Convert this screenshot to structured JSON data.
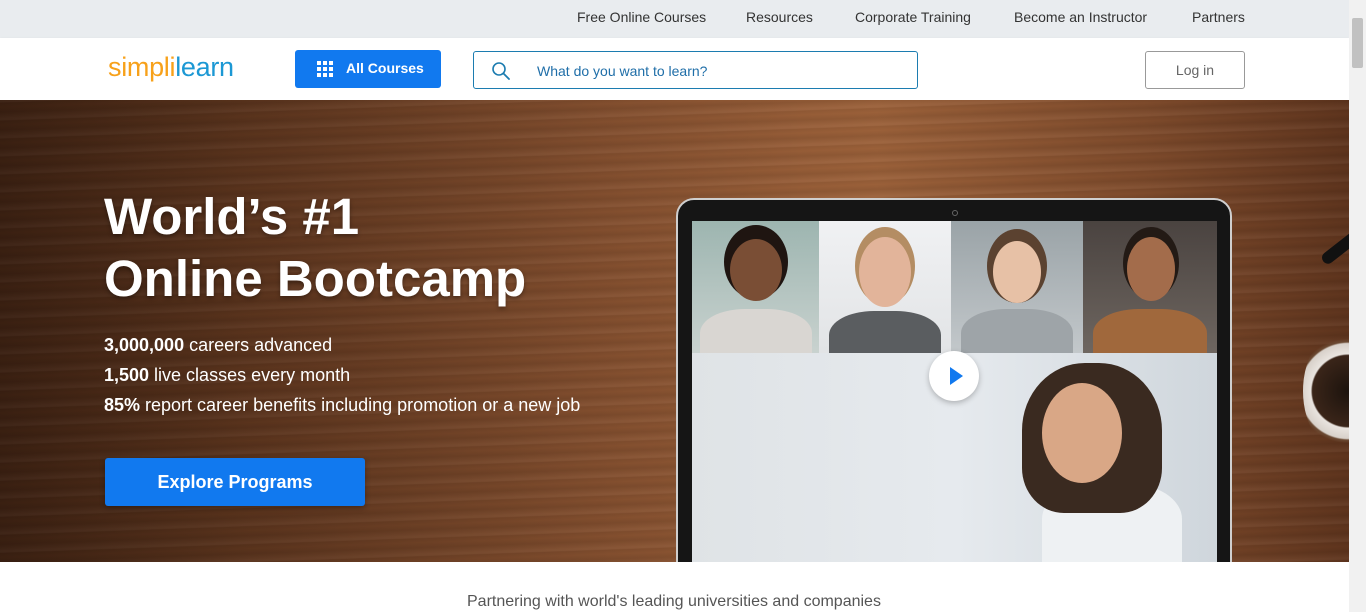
{
  "topbar": {
    "links": [
      "Free Online Courses",
      "Resources",
      "Corporate Training",
      "Become an Instructor",
      "Partners"
    ]
  },
  "header": {
    "logo": {
      "part1": "simpl",
      "divider": "i",
      "part2": "learn"
    },
    "all_courses_label": "All Courses",
    "search_placeholder": "What do you want to learn?",
    "login_label": "Log in"
  },
  "hero": {
    "title_line1": "World’s #1",
    "title_line2": "Online Bootcamp",
    "stats": [
      {
        "value": "3,000,000",
        "text": " careers advanced"
      },
      {
        "value": "1,500",
        "text": " live classes every month"
      },
      {
        "value": "85%",
        "text": " report career benefits including promotion or a new job"
      }
    ],
    "cta_label": "Explore Programs"
  },
  "partners_text": "Partnering with world's leading universities and companies",
  "colors": {
    "accent_blue": "#1179ef",
    "logo_orange": "#f7a11a",
    "logo_blue": "#1c98d4"
  },
  "icons": [
    "grid-icon",
    "search-icon",
    "play-icon"
  ]
}
